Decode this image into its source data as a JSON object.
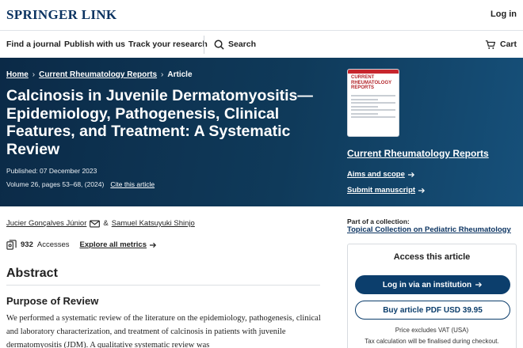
{
  "header": {
    "logo": "SPRINGER LINK",
    "login": "Log in"
  },
  "nav": {
    "items": [
      "Find a journal",
      "Publish with us",
      "Track your research"
    ],
    "search_label": "Search",
    "cart_label": "Cart"
  },
  "breadcrumb": {
    "home": "Home",
    "journal": "Current Rheumatology Reports",
    "current": "Article"
  },
  "article": {
    "title": "Calcinosis in Juvenile Dermatomyositis—Epidemiology, Pathogenesis, Clinical Features, and Treatment: A Systematic Review",
    "published": "Published: 07 December 2023",
    "volume": "Volume 26, pages 53–68, (2024)",
    "cite": "Cite this article"
  },
  "journal_panel": {
    "cover_title": "CURRENT RHEUMATOLOGY REPORTS",
    "name": "Current Rheumatology Reports",
    "aims": "Aims and scope",
    "submit": "Submit manuscript"
  },
  "authors": {
    "first": "Jucier Gonçalves Júnior",
    "joiner": "&",
    "second": "Samuel Katsuyuki Shinjo"
  },
  "metrics": {
    "accesses_count": "932",
    "accesses_label": "Accesses",
    "explore": "Explore all metrics"
  },
  "abstract": {
    "heading": "Abstract",
    "section_heading": "Purpose of Review",
    "text": "We performed a systematic review of the literature on the epidemiology, pathogenesis, clinical and laboratory characterization, and treatment of calcinosis in patients with juvenile dermatomyositis (JDM). A qualitative systematic review was"
  },
  "collection": {
    "label": "Part of a collection:",
    "link": "Topical Collection on Pediatric Rheumatology"
  },
  "access": {
    "title": "Access this article",
    "login_button": "Log in via an institution",
    "buy_button": "Buy article PDF USD 39.95",
    "vat": "Price excludes VAT (USA)",
    "tax": "Tax calculation will be finalised during checkout."
  },
  "colors": {
    "brand": "#0c3462",
    "hero_bg": "#0f3a5a",
    "button_primary": "#0c3e6c"
  }
}
